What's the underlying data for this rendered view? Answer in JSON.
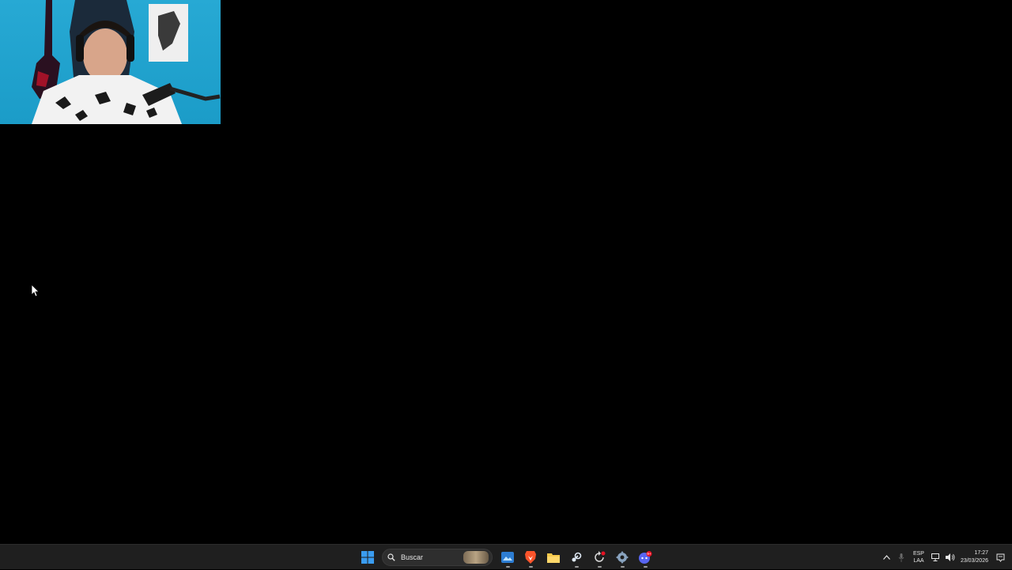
{
  "taskbar": {
    "search_placeholder": "Buscar",
    "pinned_apps": [
      {
        "name": "file-explorer-preview"
      },
      {
        "name": "brave-browser"
      },
      {
        "name": "file-explorer"
      },
      {
        "name": "steam"
      },
      {
        "name": "update-app"
      },
      {
        "name": "settings"
      },
      {
        "name": "discord",
        "badge": "9+"
      }
    ],
    "tray": {
      "language_line1": "ESP",
      "language_line2": "LAA",
      "time": "17:27",
      "date": "23/03/2026"
    }
  },
  "colors": {
    "desktop_bg": "#000000",
    "taskbar_bg": "#1f1f1f",
    "webcam_bg": "#1ea3cf",
    "windows_blue": "#2f8fe8"
  }
}
